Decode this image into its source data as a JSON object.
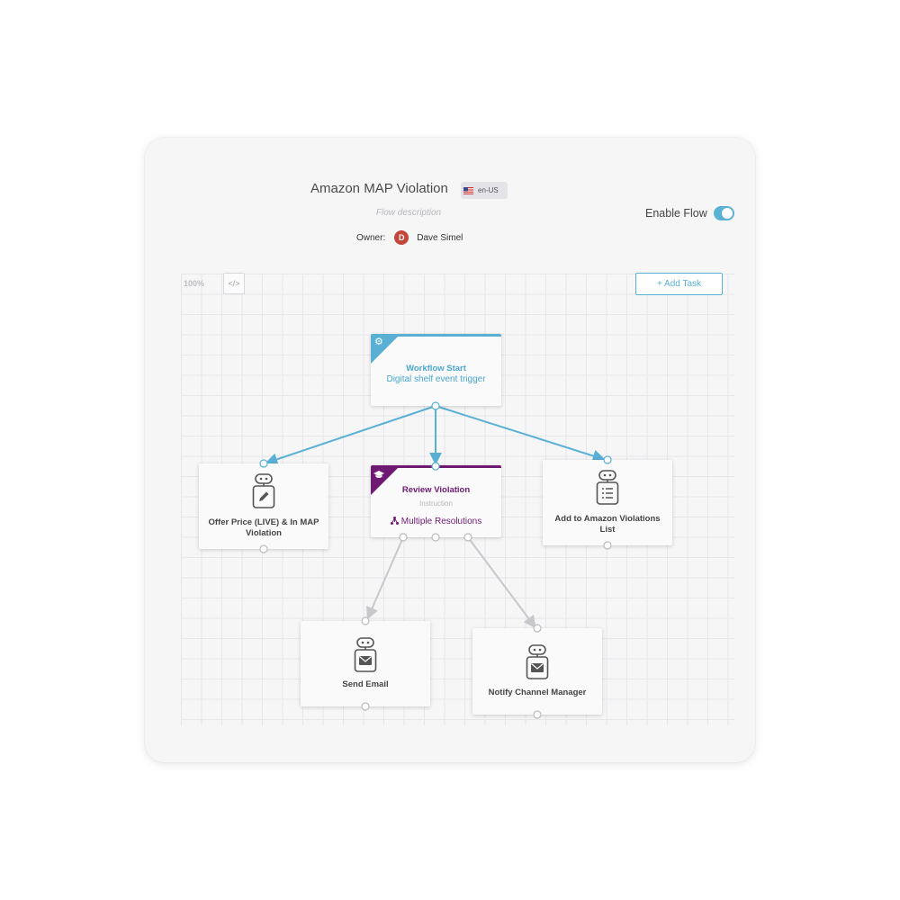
{
  "header": {
    "title": "Amazon MAP Violation",
    "language": "en-US",
    "description_placeholder": "Flow description",
    "owner_label": "Owner:",
    "owner_initial": "D",
    "owner_name": "Dave Simel",
    "enable_flow_label": "Enable Flow",
    "enable_flow_on": true
  },
  "toolbar": {
    "zoom": "100%",
    "code_button": "</>",
    "add_task_label": "+ Add Task"
  },
  "nodes": {
    "workflow_start": {
      "title": "Workflow Start",
      "subtitle": "Digital shelf event trigger",
      "icon": "gear-icon"
    },
    "review_violation": {
      "title": "Review Violation",
      "type": "Instruction",
      "resolution": "Multiple Resolutions",
      "icon": "graduation-cap-icon"
    },
    "offer_price": {
      "label": "Offer Price (LIVE) & In MAP Violation",
      "icon": "pencil-icon"
    },
    "add_to_list": {
      "label": "Add to Amazon Violations List",
      "icon": "list-icon"
    },
    "send_email": {
      "label": "Send Email",
      "icon": "envelope-icon"
    },
    "notify_manager": {
      "label": "Notify Channel Manager",
      "icon": "envelope-icon"
    }
  },
  "colors": {
    "accent_blue": "#59b0d4",
    "accent_purple": "#6e1a73",
    "owner_avatar": "#c4453a",
    "edge_grey": "#c8c8cc"
  }
}
